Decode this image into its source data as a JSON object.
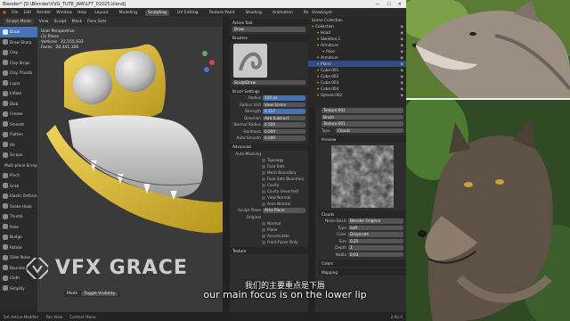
{
  "window": {
    "title": "Blender* [D:\\Blender\\VVG_TUT8_JAW\\LFT_01025.blend]",
    "controls": [
      "—",
      "☐",
      "✕"
    ]
  },
  "menubar": {
    "items": [
      "File",
      "Edit",
      "Render",
      "Window",
      "Help"
    ],
    "workspaces": [
      "Layout",
      "Modeling",
      "Sculpting",
      "UV Editing",
      "Texture Paint",
      "Shading",
      "Animation",
      "Rendering",
      "Compositing"
    ],
    "active_workspace": "Sculpting",
    "scene_label": "Scene",
    "view_layer_label": "ViewLayer"
  },
  "tool_header": {
    "mode": "Sculpt Mode",
    "menus": [
      "View",
      "Sculpt",
      "Mask",
      "Face Sets"
    ],
    "brush": "SculptDraw",
    "radius_label": "Radius",
    "radius_value": "110 px",
    "strength_label": "Strength",
    "strength_value": "0.117",
    "extra": [
      "Brush",
      "Texture",
      "Stroke",
      "Falloff",
      "Cursor"
    ]
  },
  "toolbar": {
    "tools": [
      "Draw",
      "Draw Sharp",
      "Clay",
      "Clay Strips",
      "Clay Thumb",
      "Layer",
      "Inflate",
      "Blob",
      "Crease",
      "Smooth",
      "Flatten",
      "Fill",
      "Scrape",
      "Multi-plane Scrape",
      "Pinch",
      "Grab",
      "Elastic Deform",
      "Snake Hook",
      "Thumb",
      "Pose",
      "Nudge",
      "Rotate",
      "Slide Relax",
      "Boundary",
      "Cloth",
      "Simplify"
    ],
    "active": "Draw"
  },
  "viewport": {
    "header_info": [
      "User Perspective",
      "(1) Plane"
    ],
    "stats": [
      {
        "label": "Vertices",
        "value": "22,555,932"
      },
      {
        "label": "Faces",
        "value": "20,441,306"
      }
    ],
    "bottom_mode_label": "Mode",
    "bottom_mode_value": "Toggle Visibility"
  },
  "properties": {
    "active_tool_section": "Active Tool",
    "tool_name": "Draw",
    "brushes_section": "Brushes",
    "brush_name": "SculptDraw",
    "brush_settings_section": "Brush Settings",
    "rows": [
      {
        "label": "Radius",
        "value": "110 px",
        "blue": true
      },
      {
        "label": "Radius Unit",
        "value": "View   Scene",
        "blue": false
      },
      {
        "label": "Strength",
        "value": "0.117",
        "blue": true
      },
      {
        "label": "Direction",
        "value": "Add   Subtract",
        "blue": false
      },
      {
        "label": "Normal Radius",
        "value": "0.500",
        "blue": false
      },
      {
        "label": "Hardness",
        "value": "0.000",
        "blue": false
      },
      {
        "label": "Auto-Smooth",
        "value": "0.000",
        "blue": false
      }
    ],
    "advanced_section": "Advanced",
    "auto_masking_label": "Auto-Masking",
    "auto_masking": [
      {
        "label": "Topology",
        "on": false
      },
      {
        "label": "Face Sets",
        "on": false
      },
      {
        "label": "Mesh Boundary",
        "on": false
      },
      {
        "label": "Face Sets Boundary",
        "on": false
      },
      {
        "label": "Cavity",
        "on": false
      },
      {
        "label": "Cavity (inverted)",
        "on": false
      },
      {
        "label": "View Normal",
        "on": false
      },
      {
        "label": "Area Normal",
        "on": false
      }
    ],
    "sculpt_plane_label": "Sculpt Plane",
    "sculpt_plane_value": "Area Plane",
    "original_label": "Original",
    "original": [
      {
        "label": "Normal",
        "on": false
      },
      {
        "label": "Plane",
        "on": false
      }
    ],
    "extra": [
      {
        "label": "Accumulate",
        "on": false
      },
      {
        "label": "Front Faces Only",
        "on": false
      }
    ],
    "texture_section": "Texture"
  },
  "outliner": {
    "header": "Scene Collection",
    "rows": [
      {
        "label": "Collection",
        "sel": false,
        "indent": 4
      },
      {
        "label": "Head",
        "sel": false,
        "indent": 10
      },
      {
        "label": "Skeleton.1",
        "sel": false,
        "indent": 10
      },
      {
        "label": "Armature",
        "sel": false,
        "indent": 10
      },
      {
        "label": "Pose",
        "sel": false,
        "indent": 16
      },
      {
        "label": "Armature",
        "sel": false,
        "indent": 10
      },
      {
        "label": "Plane",
        "sel": true,
        "indent": 10
      },
      {
        "label": "Cube.001",
        "sel": false,
        "indent": 10
      },
      {
        "label": "Cube.002",
        "sel": false,
        "indent": 10
      },
      {
        "label": "Cube.003",
        "sel": false,
        "indent": 10
      },
      {
        "label": "Cube.004",
        "sel": false,
        "indent": 10
      },
      {
        "label": "Sphere.002",
        "sel": false,
        "indent": 10
      }
    ]
  },
  "texture_panel": {
    "tex_name": "Texture.001",
    "brush_label": "Brush",
    "tex_name2": "Texture.001",
    "type_label": "Type",
    "type_value": "Clouds",
    "preview_section": "Preview",
    "clouds_section": "Clouds",
    "rows": [
      {
        "label": "Noise Basis",
        "value": "Blender Original"
      },
      {
        "label": "Type",
        "value": "Soft"
      },
      {
        "label": "Color",
        "value": "Grayscale"
      },
      {
        "label": "Size",
        "value": "0.25"
      },
      {
        "label": "Depth",
        "value": "2"
      },
      {
        "label": "Nabla",
        "value": "0.03"
      }
    ],
    "colors_section": "Colors",
    "mapping_section": "Mapping"
  },
  "statusbar": {
    "items": [
      "Set Active Modifier",
      "Pan View",
      "Context Menu"
    ],
    "version": "2.92.0"
  },
  "overlay": {
    "logo_text": "VFX GRACE",
    "subtitle_cn": "我们的主要重点是下唇",
    "subtitle_en": "our main focus is on the lower lip"
  },
  "colors": {
    "accent": "#4772b3",
    "model_yellow": "#d8b832",
    "model_gray": "#cfcfcf",
    "viewport_bg": "#3a3a3a"
  }
}
